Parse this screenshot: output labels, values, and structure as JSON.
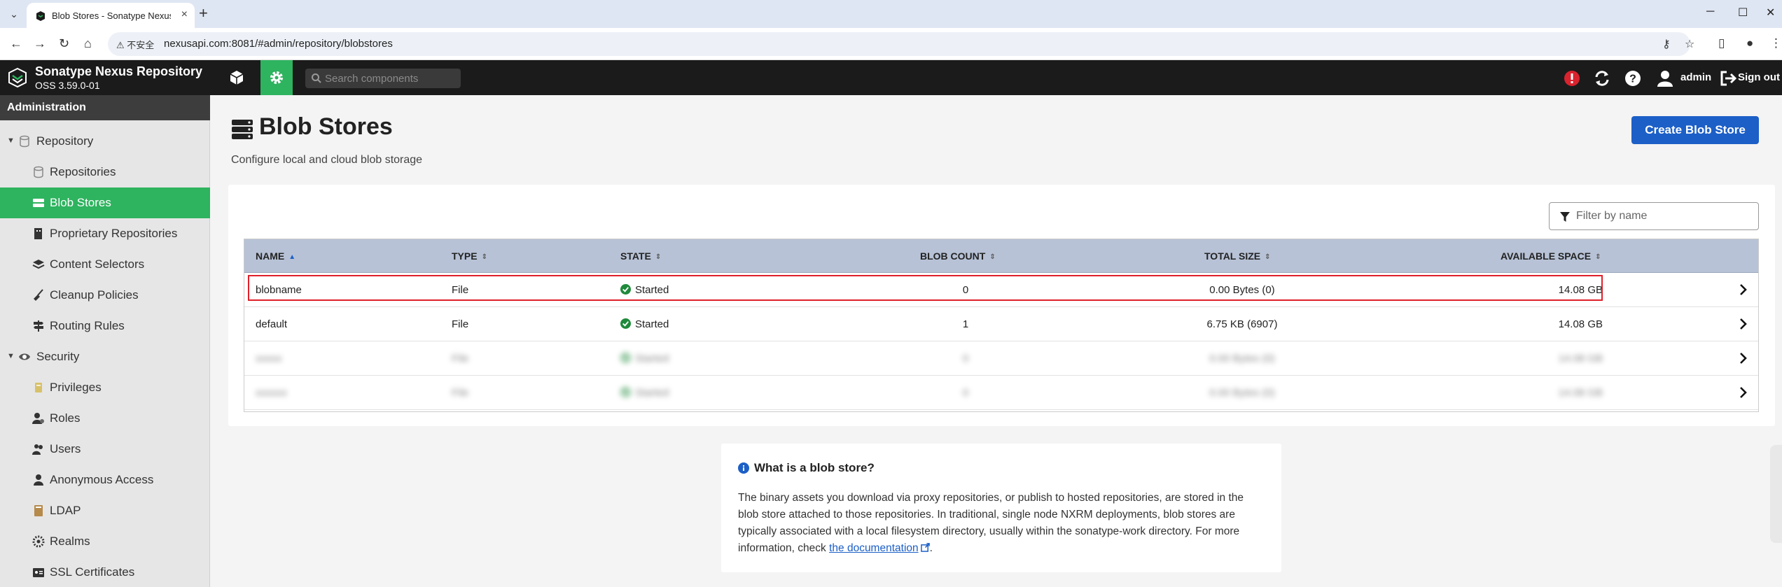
{
  "browser": {
    "tab_title": "Blob Stores - Sonatype Nexus",
    "tab_close": "×",
    "new_tab": "+",
    "security_warning": "不安全",
    "url": "nexusapi.com:8081/#admin/repository/blobstores"
  },
  "header": {
    "brand": "Sonatype Nexus Repository",
    "version": "OSS 3.59.0-01",
    "search_placeholder": "Search components",
    "user": "admin",
    "sign_out": "Sign out",
    "accent_color": "#2eb35f"
  },
  "sidebar": {
    "title": "Administration",
    "items": [
      {
        "label": "Repository",
        "icon": "database-icon",
        "level": "group"
      },
      {
        "label": "Repositories",
        "icon": "database-icon",
        "level": "child"
      },
      {
        "label": "Blob Stores",
        "icon": "server-icon",
        "level": "child",
        "active": true
      },
      {
        "label": "Proprietary Repositories",
        "icon": "building-icon",
        "level": "child"
      },
      {
        "label": "Content Selectors",
        "icon": "layers-icon",
        "level": "child"
      },
      {
        "label": "Cleanup Policies",
        "icon": "broom-icon",
        "level": "child"
      },
      {
        "label": "Routing Rules",
        "icon": "signpost-icon",
        "level": "child"
      },
      {
        "label": "Security",
        "icon": "eye-icon",
        "level": "group"
      },
      {
        "label": "Privileges",
        "icon": "certificate-icon",
        "level": "child"
      },
      {
        "label": "Roles",
        "icon": "users-cog-icon",
        "level": "child"
      },
      {
        "label": "Users",
        "icon": "users-icon",
        "level": "child"
      },
      {
        "label": "Anonymous Access",
        "icon": "user-icon",
        "level": "child"
      },
      {
        "label": "LDAP",
        "icon": "book-icon",
        "level": "child"
      },
      {
        "label": "Realms",
        "icon": "realms-icon",
        "level": "child"
      },
      {
        "label": "SSL Certificates",
        "icon": "id-card-icon",
        "level": "child"
      }
    ]
  },
  "main": {
    "title": "Blob Stores",
    "subtitle": "Configure local and cloud blob storage",
    "create_button": "Create Blob Store",
    "filter_placeholder": "Filter by name",
    "columns": [
      "NAME",
      "TYPE",
      "STATE",
      "BLOB COUNT",
      "TOTAL SIZE",
      "AVAILABLE SPACE"
    ],
    "rows": [
      {
        "name": "blobname",
        "type": "File",
        "state": "Started",
        "blob_count": "0",
        "total_size": "0.00 Bytes (0)",
        "available_space": "14.08 GB"
      },
      {
        "name": "default",
        "type": "File",
        "state": "Started",
        "blob_count": "1",
        "total_size": "6.75 KB (6907)",
        "available_space": "14.08 GB"
      },
      {
        "name": "xxxxx",
        "type": "File",
        "state": "Started",
        "blob_count": "0",
        "total_size": "0.00 Bytes (0)",
        "available_space": "14.08 GB"
      },
      {
        "name": "xxxxxx",
        "type": "File",
        "state": "Started",
        "blob_count": "0",
        "total_size": "0.00 Bytes (0)",
        "available_space": "14.08 GB"
      }
    ]
  },
  "info": {
    "title": "What is a blob store?",
    "body": "The binary assets you download via proxy repositories, or publish to hosted repositories, are stored in the blob store attached to those repositories. In traditional, single node NXRM deployments, blob stores are typically associated with a local filesystem directory, usually within the sonatype-work directory. For more information, check ",
    "link": "the documentation",
    "end": "."
  }
}
